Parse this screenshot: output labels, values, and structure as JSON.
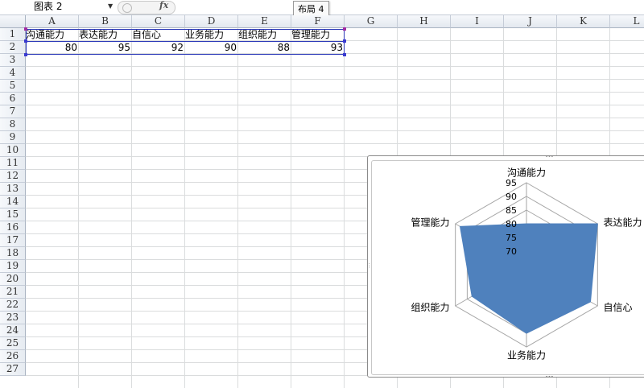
{
  "formula_bar": {
    "name_box": "图表 2",
    "fx_label": "fx",
    "tooltip": "布局 4"
  },
  "columns": [
    "A",
    "B",
    "C",
    "D",
    "E",
    "F",
    "G",
    "H",
    "I",
    "J",
    "K",
    "L"
  ],
  "rows": [
    "1",
    "2",
    "3",
    "4",
    "5",
    "6",
    "7",
    "8",
    "9",
    "10",
    "11",
    "12",
    "13",
    "14",
    "15",
    "16",
    "17",
    "18",
    "19",
    "20",
    "21",
    "22",
    "23",
    "24",
    "25",
    "26",
    "27"
  ],
  "sheet": {
    "row1": [
      "沟通能力",
      "表达能力",
      "自信心",
      "业务能力",
      "组织能力",
      "管理能力"
    ],
    "row2": [
      "80",
      "95",
      "92",
      "90",
      "88",
      "93"
    ]
  },
  "chart_data": {
    "type": "radar",
    "categories": [
      "沟通能力",
      "表达能力",
      "自信心",
      "业务能力",
      "组织能力",
      "管理能力"
    ],
    "series": [
      {
        "values": [
          80,
          95,
          92,
          90,
          88,
          93
        ]
      }
    ],
    "axis_ticks": [
      "70",
      "75",
      "80",
      "85",
      "90",
      "95"
    ],
    "rmin": 65,
    "rmax": 95,
    "fill_color": "#4f81bd",
    "grid_color": "#a6a6a6"
  }
}
